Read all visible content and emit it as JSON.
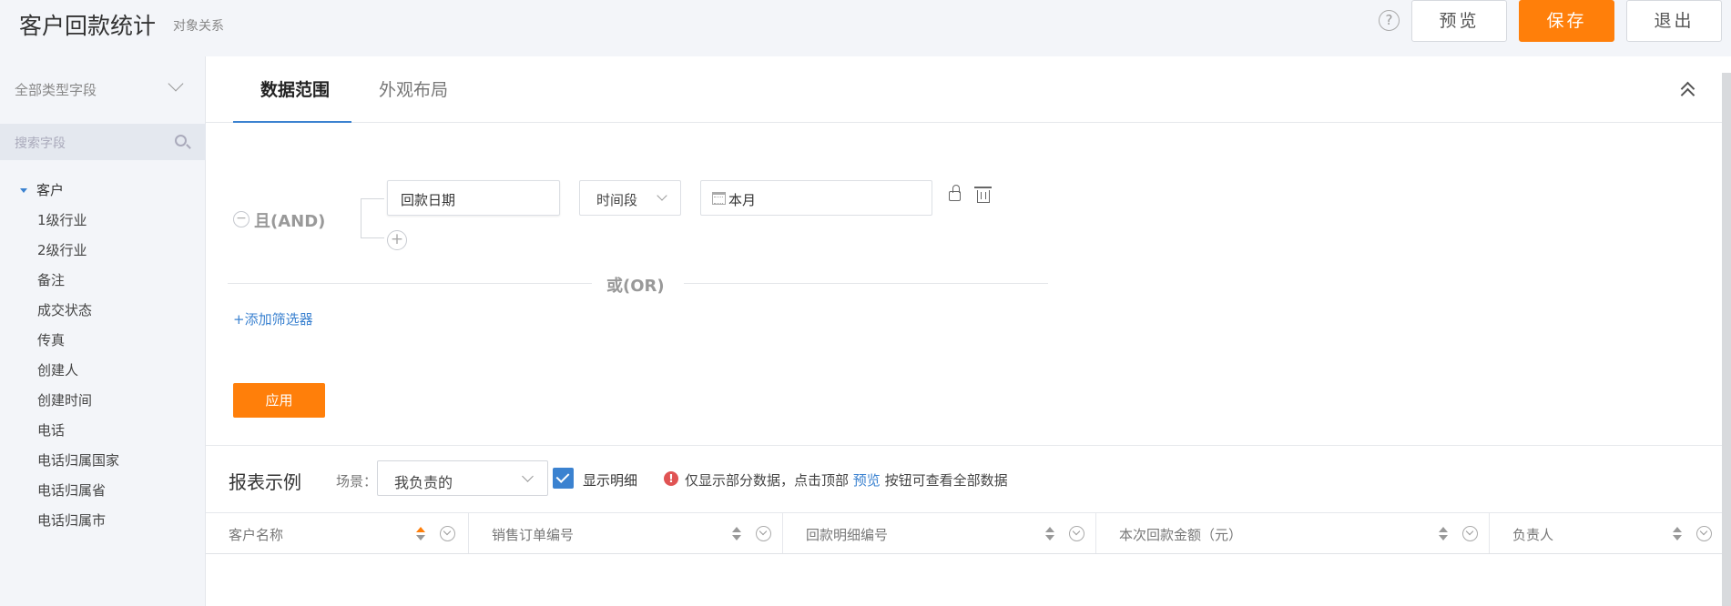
{
  "header": {
    "title": "客户回款统计",
    "subtitle": "对象关系",
    "help_icon": "?",
    "preview_label": "预览",
    "save_label": "保存",
    "exit_label": "退出"
  },
  "sidebar": {
    "field_type_label": "全部类型字段",
    "search_placeholder": "搜索字段",
    "root_label": "客户",
    "items": [
      "1级行业",
      "2级行业",
      "备注",
      "成交状态",
      "传真",
      "创建人",
      "创建时间",
      "电话",
      "电话归属国家",
      "电话归属省",
      "电话归属市"
    ]
  },
  "tabs": [
    {
      "label": "数据范围",
      "active": true
    },
    {
      "label": "外观布局",
      "active": false
    }
  ],
  "filter": {
    "and_label": "且(AND)",
    "field": "回款日期",
    "operator": "时间段",
    "value": "本月",
    "or_label": "或(OR)",
    "add_filter_label": "+添加筛选器",
    "apply_label": "应用"
  },
  "report": {
    "title": "报表示例",
    "scene_label": "场景：",
    "scene_value": "我负责的",
    "show_detail_label": "显示明细",
    "show_detail_checked": true,
    "notice_before": "仅显示部分数据，点击顶部",
    "notice_link": "预览",
    "notice_after": "按钮可查看全部数据",
    "columns": [
      "客户名称",
      "销售订单编号",
      "回款明细编号",
      "本次回款金额（元）",
      "负责人"
    ]
  },
  "colors": {
    "accent": "#ff7f0a",
    "link": "#3b82d0",
    "warning": "#e05353"
  }
}
